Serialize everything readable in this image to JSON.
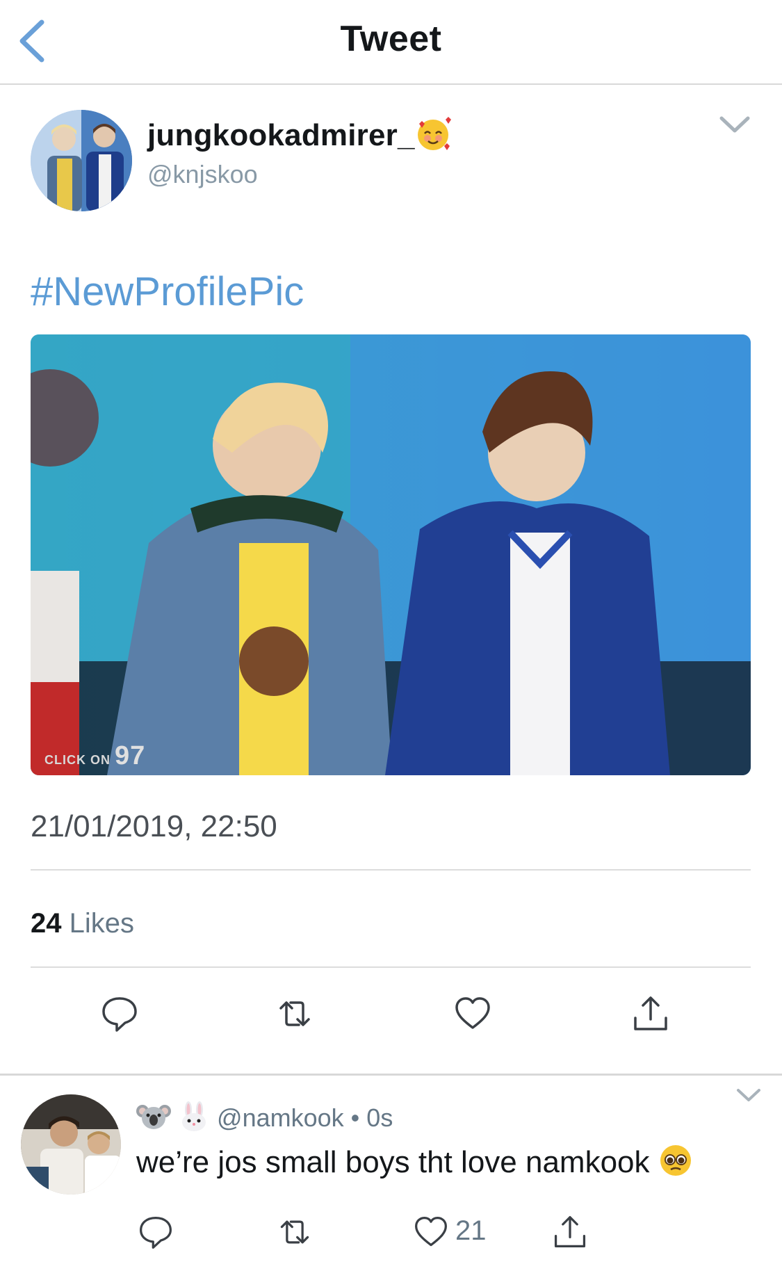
{
  "nav": {
    "title": "Tweet",
    "back_icon": "chevron-left-icon"
  },
  "tweet": {
    "display_name": "jungkookadmirer_",
    "display_name_emoji": "smiling-face-with-hearts-icon",
    "handle": "@knjskoo",
    "hashtag": "#NewProfilePic",
    "media_watermark_text": "CLICK ON",
    "media_watermark_number": "97",
    "timestamp": "21/01/2019, 22:50",
    "likes_count": "24",
    "likes_label": "Likes",
    "actions": [
      "reply-icon",
      "retweet-icon",
      "like-icon",
      "share-icon"
    ]
  },
  "reply": {
    "emojis": [
      "koala-face-icon",
      "rabbit-face-icon"
    ],
    "handle": "@namkook",
    "separator": "•",
    "time": "0s",
    "text": "we’re jos small boys tht love namkook",
    "text_emoji": "pleading-face-icon",
    "like_count": "21",
    "actions": [
      "reply-icon",
      "retweet-icon",
      "like-icon",
      "share-icon"
    ]
  },
  "colors": {
    "link": "#5b9bd5",
    "muted": "#657786",
    "divider": "#dcdcdc",
    "back_icon": "#6aa0d8"
  }
}
